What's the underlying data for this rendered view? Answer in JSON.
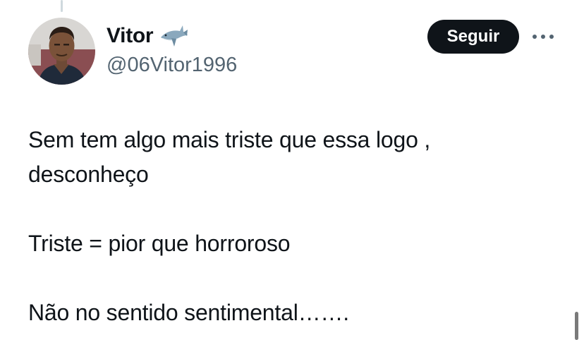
{
  "author": {
    "display_name": "Vitor",
    "badge_emoji": "shark-emoji",
    "handle": "@06Vitor1996",
    "avatar": "profile-photo"
  },
  "actions": {
    "follow_label": "Seguir",
    "more_icon": "more-horizontal-icon"
  },
  "tweet": {
    "paragraphs": [
      "Sem tem algo mais triste que essa logo ,",
      "desconheço",
      "Triste = pior que horroroso",
      "Não no sentido sentimental……."
    ]
  },
  "colors": {
    "text_primary": "#0f1419",
    "text_secondary": "#536471",
    "button_bg": "#0f1419",
    "button_text": "#ffffff",
    "thread_line": "#cfd9de"
  }
}
